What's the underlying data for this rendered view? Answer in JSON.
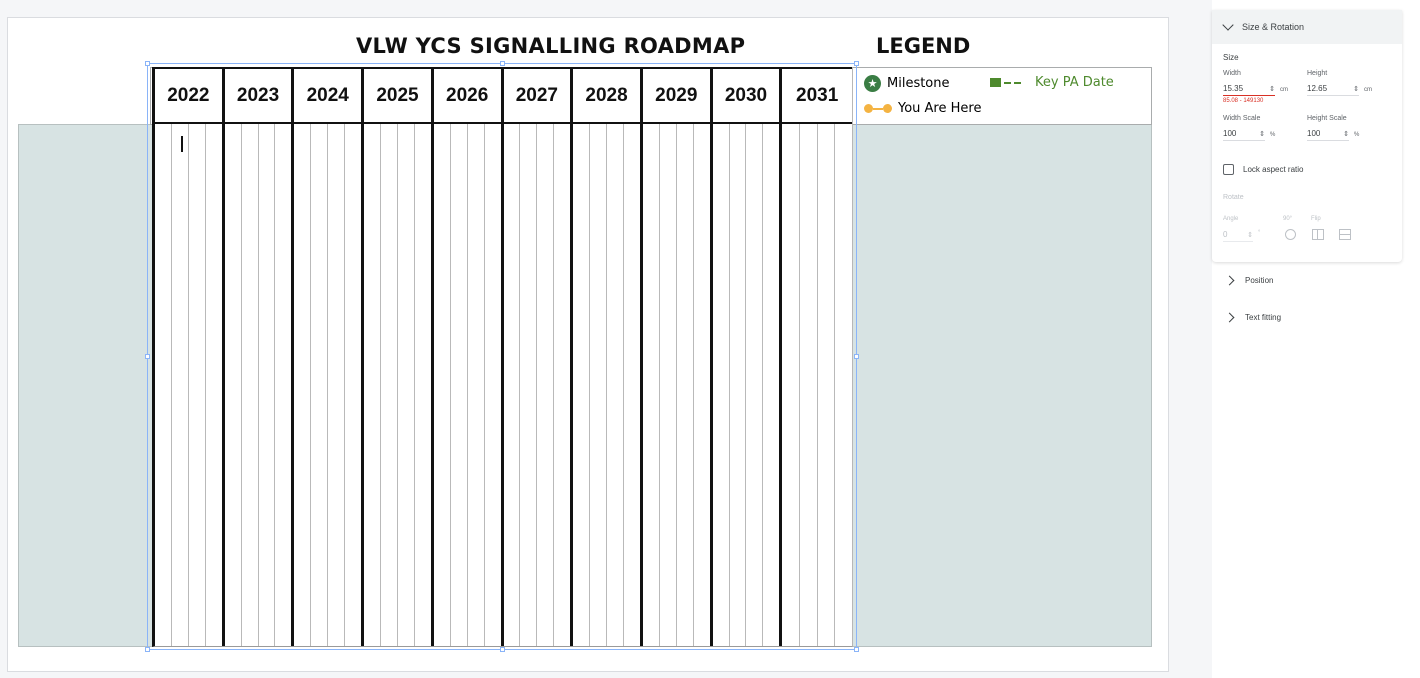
{
  "slide": {
    "title": "VLW YCS SIGNALLING ROADMAP",
    "legend_title": "LEGEND",
    "years": [
      "2022",
      "2023",
      "2024",
      "2025",
      "2026",
      "2027",
      "2028",
      "2029",
      "2030",
      "2031"
    ],
    "legend": {
      "milestone": "Milestone",
      "key_pa_date": "Key PA Date",
      "you_are_here": "You Are Here"
    },
    "colors": {
      "band": "#d7e3e3",
      "milestone": "#3a7d44",
      "key_pa": "#4e8a2d",
      "you_are_here": "#f4b342"
    }
  },
  "panel": {
    "section_title": "Size & Rotation",
    "size_label": "Size",
    "width_label": "Width",
    "height_label": "Height",
    "width_value": "15.35",
    "height_value": "12.65",
    "width_unit": "cm",
    "height_unit": "cm",
    "width_error": "85.08 - 149130",
    "width_scale_label": "Width Scale",
    "height_scale_label": "Height Scale",
    "width_scale_value": "100",
    "height_scale_value": "100",
    "scale_unit": "%",
    "lock_label": "Lock aspect ratio",
    "rotate_label": "Rotate",
    "angle_label": "Angle",
    "ninety_label": "90°",
    "flip_label": "Flip",
    "angle_value": "0",
    "angle_unit": "°",
    "position_label": "Position",
    "text_fitting_label": "Text fitting"
  }
}
